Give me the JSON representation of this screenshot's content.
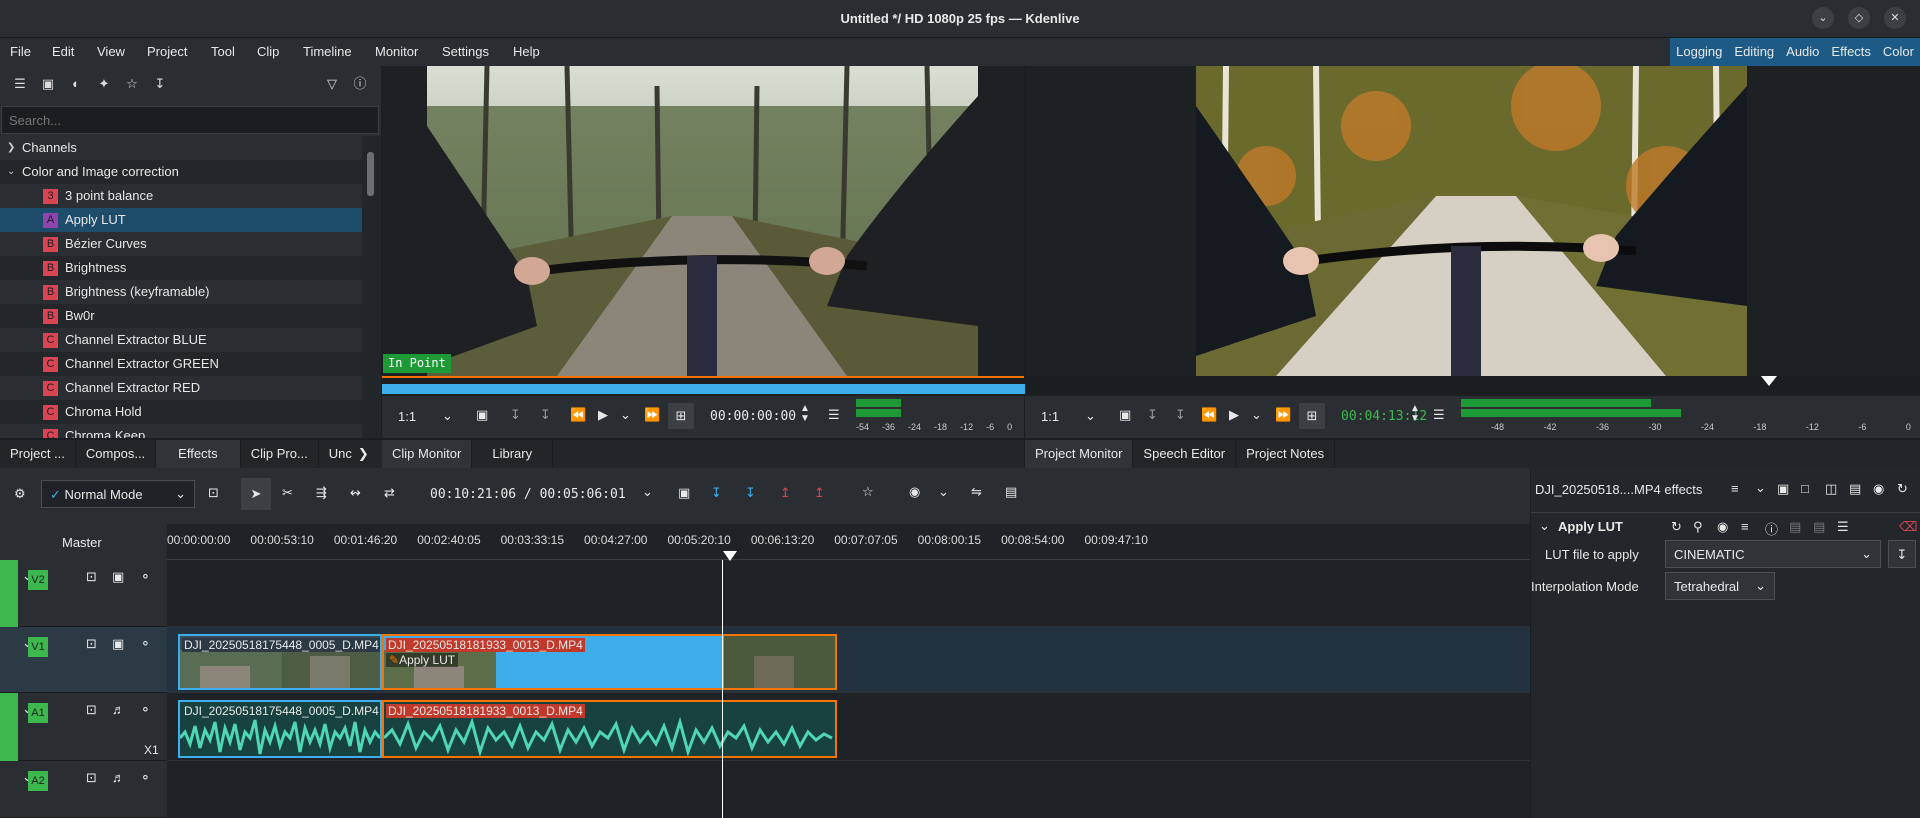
{
  "window": {
    "title": "Untitled */ HD 1080p 25 fps — Kdenlive"
  },
  "menu": [
    "File",
    "Edit",
    "View",
    "Project",
    "Tool",
    "Clip",
    "Timeline",
    "Monitor",
    "Settings",
    "Help"
  ],
  "layouts": [
    "Logging",
    "Editing",
    "Audio",
    "Effects",
    "Color"
  ],
  "effects_panel": {
    "search_placeholder": "Search...",
    "categories": [
      {
        "label": "Channels"
      },
      {
        "label": "Color and Image correction"
      }
    ],
    "items": [
      {
        "badge": "3",
        "label": "3 point balance"
      },
      {
        "badge": "A",
        "label": "Apply LUT"
      },
      {
        "badge": "B",
        "label": "Bézier Curves"
      },
      {
        "badge": "B",
        "label": "Brightness"
      },
      {
        "badge": "B",
        "label": "Brightness (keyframable)"
      },
      {
        "badge": "B",
        "label": "Bw0r"
      },
      {
        "badge": "C",
        "label": "Channel Extractor BLUE"
      },
      {
        "badge": "C",
        "label": "Channel Extractor GREEN"
      },
      {
        "badge": "C",
        "label": "Channel Extractor RED"
      },
      {
        "badge": "C",
        "label": "Chroma Hold"
      },
      {
        "badge": "C",
        "label": "Chroma Keep"
      }
    ],
    "tabs": [
      "Project ...",
      "Compos...",
      "Effects",
      "Clip Pro...",
      "Unc"
    ]
  },
  "clip_monitor": {
    "overlay": "In Point",
    "zoom": "1:1",
    "timecode": "00:00:00:00",
    "meter_labels": [
      "-54",
      "-36",
      "-24",
      "-18",
      "-12",
      "-6",
      "0"
    ],
    "tabs": [
      "Clip Monitor",
      "Library"
    ]
  },
  "project_monitor": {
    "zoom": "1:1",
    "timecode": "00:04:13:12",
    "meter_labels": [
      "-48",
      "-42",
      "-36",
      "-30",
      "-24",
      "-18",
      "-12",
      "-6",
      "0"
    ],
    "tabs": [
      "Project Monitor",
      "Speech Editor",
      "Project Notes"
    ]
  },
  "timeline": {
    "mode": "Normal Mode",
    "timecode": "00:10:21:06 / 00:05:06:01",
    "master": "Master",
    "ruler": [
      "00:00:00:00",
      "00:00:53:10",
      "00:01:46:20",
      "00:02:40:05",
      "00:03:33:15",
      "00:04:27:00",
      "00:05:20:10",
      "00:06:13:20",
      "00:07:07:05",
      "00:08:00:15",
      "00:08:54:00",
      "00:09:47:10"
    ],
    "tracks": [
      {
        "label": "V2"
      },
      {
        "label": "V1"
      },
      {
        "label": "A1",
        "extra": "X1"
      },
      {
        "label": "A2"
      }
    ],
    "clips": {
      "clip1_name": "DJI_20250518175448_0005_D.MP4",
      "clip2_name": "DJI_20250518181933_0013_D.MP4",
      "clip2_effect": "Apply LUT"
    }
  },
  "effect_stack": {
    "header": "DJI_20250518....MP4 effects",
    "effect_name": "Apply LUT",
    "param1_label": "LUT file to apply",
    "param1_value": "CINEMATIC",
    "param2_label": "Interpolation Mode",
    "param2_value": "Tetrahedral"
  },
  "colors": {
    "accent": "#1d5b86",
    "selection": "#3daee9",
    "clip_border": "#f67400",
    "track_green": "#3db84f",
    "badge_red": "#da4453"
  }
}
